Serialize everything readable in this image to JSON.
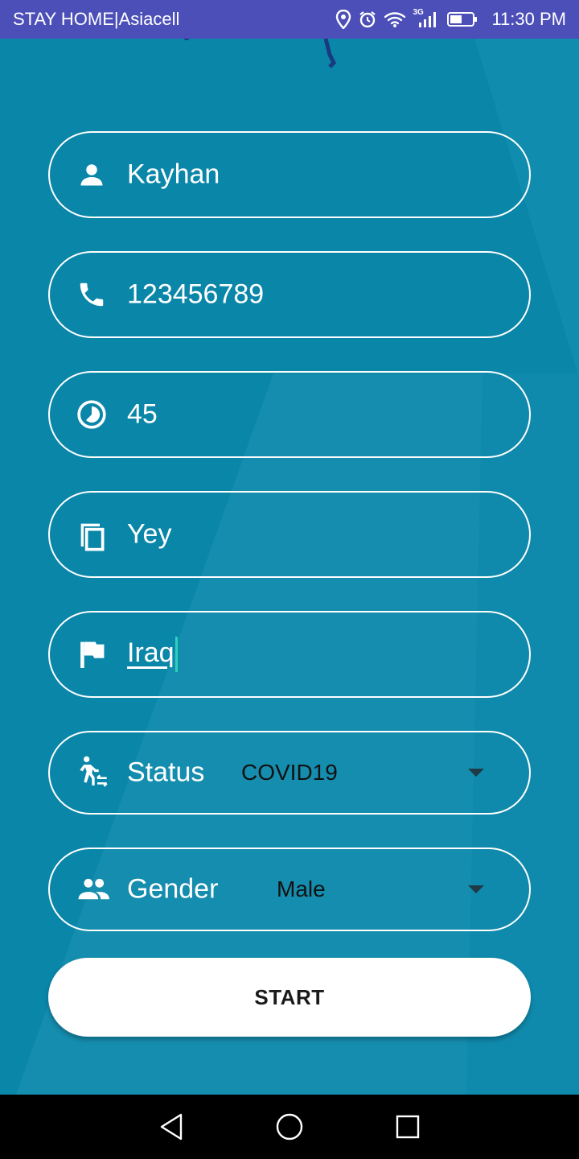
{
  "status_bar": {
    "carrier": "STAY HOME|Asiacell",
    "network": "3G",
    "time": "11:30 PM",
    "icons": [
      "location-icon",
      "alarm-icon",
      "wifi-icon",
      "signal-icon",
      "battery-icon"
    ]
  },
  "form": {
    "name": {
      "value": "Kayhan",
      "icon": "person-icon"
    },
    "phone": {
      "value": "123456789",
      "icon": "phone-icon"
    },
    "age": {
      "value": "45",
      "icon": "clock-icon"
    },
    "other": {
      "value": "Yey",
      "icon": "copy-icon"
    },
    "country": {
      "value": "Iraq",
      "icon": "flag-icon"
    },
    "status": {
      "label": "Status",
      "selected": "COVID19",
      "icon": "walk-transfer-icon"
    },
    "gender": {
      "label": "Gender",
      "selected": "Male",
      "icon": "people-icon"
    }
  },
  "start_button": {
    "label": "START"
  },
  "nav_bar": {
    "buttons": [
      "back-icon",
      "home-icon",
      "recents-icon"
    ]
  },
  "colors": {
    "background": "#0a86a9",
    "status_bar": "#4c4fb8",
    "caret": "#2ad1c0"
  }
}
